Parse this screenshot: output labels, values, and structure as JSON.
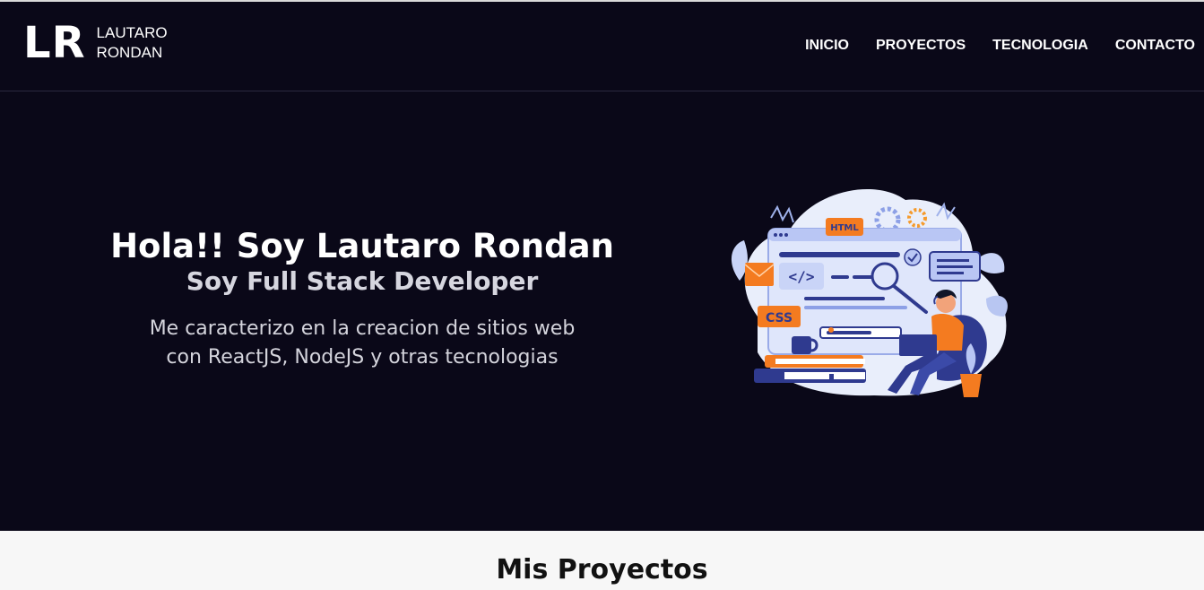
{
  "header": {
    "logo_mark": "LR",
    "logo_name_line1": "LAUTARO",
    "logo_name_line2": "RONDAN",
    "nav": [
      "INICIO",
      "PROYECTOS",
      "TECNOLOGIA",
      "CONTACTO"
    ]
  },
  "hero": {
    "title": "Hola!! Soy Lautaro Rondan",
    "subtitle": "Soy Full Stack Developer",
    "description_line1": "Me caracterizo en la creacion de sitios web",
    "description_line2": "con ReactJS, NodeJS y otras tecnologias",
    "illustration": {
      "code_tag": "</>",
      "html_tag": "HTML",
      "css_tag": "CSS",
      "colors": {
        "accent_orange": "#f47b20",
        "accent_blue": "#2f3a8f",
        "light_blue": "#c9d4f7",
        "panel": "#e8edfc"
      }
    }
  },
  "projects": {
    "title": "Mis Proyectos"
  },
  "colors": {
    "background_dark": "#0a0818",
    "section_light": "#f7f7f7",
    "text_white": "#ffffff",
    "text_muted": "#d6d6df"
  }
}
